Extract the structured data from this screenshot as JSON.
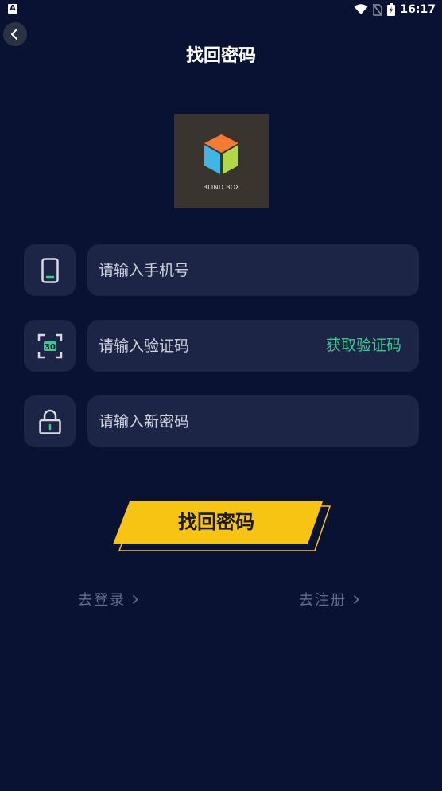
{
  "status_bar": {
    "app_badge": "A",
    "time": "16:17"
  },
  "header": {
    "title": "找回密码"
  },
  "logo": {
    "text": "BLIND BOX"
  },
  "form": {
    "phone_placeholder": "请输入手机号",
    "code_placeholder": "请输入验证码",
    "get_code_label": "获取验证码",
    "code_icon_text": "30",
    "password_placeholder": "请输入新密码"
  },
  "submit": {
    "label": "找回密码"
  },
  "links": {
    "login": "去登录",
    "register": "去注册"
  },
  "colors": {
    "background": "#0a1233",
    "field_background": "#1d2547",
    "accent_green": "#3fc98f",
    "button_yellow": "#f7c413"
  }
}
